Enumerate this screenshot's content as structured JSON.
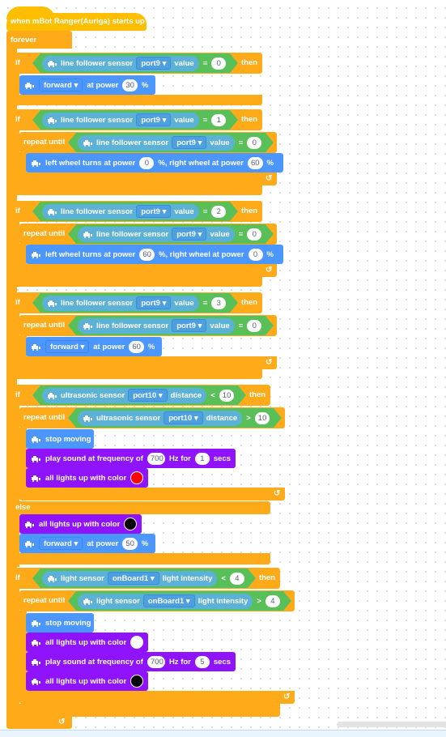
{
  "hat": {
    "label": "when mBot Ranger(Auriga) starts up"
  },
  "forever": {
    "label": "forever"
  },
  "keywords": {
    "if": "if",
    "then": "then",
    "else": "else",
    "repeat_until": "repeat until",
    "percent": "%",
    "loop_arrow": "↺"
  },
  "blocks": {
    "if1": {
      "cond": {
        "sensor": "line follower sensor",
        "port": "port9",
        "field": "value",
        "op": "=",
        "value": "0"
      },
      "body": [
        {
          "type": "move",
          "direction": "forward",
          "at_power": "at power",
          "power": "30",
          "unit": "%"
        }
      ]
    },
    "if2": {
      "cond": {
        "sensor": "line follower sensor",
        "port": "port9",
        "field": "value",
        "op": "=",
        "value": "1"
      },
      "until": {
        "sensor": "line follower sensor",
        "port": "port9",
        "field": "value",
        "op": "=",
        "value": "0"
      },
      "body": [
        {
          "type": "wheels",
          "left_label": "left wheel turns at power",
          "left": "0",
          "mid": "%,  right wheel at power",
          "right": "60",
          "unit": "%"
        }
      ]
    },
    "if3": {
      "cond": {
        "sensor": "line follower sensor",
        "port": "port9",
        "field": "value",
        "op": "=",
        "value": "2"
      },
      "until": {
        "sensor": "line follower sensor",
        "port": "port9",
        "field": "value",
        "op": "=",
        "value": "0"
      },
      "body": [
        {
          "type": "wheels",
          "left_label": "left wheel turns at power",
          "left": "60",
          "mid": "%,  right wheel at power",
          "right": "0",
          "unit": "%"
        }
      ]
    },
    "if4": {
      "cond": {
        "sensor": "line follower sensor",
        "port": "port9",
        "field": "value",
        "op": "=",
        "value": "3"
      },
      "until": {
        "sensor": "line follower sensor",
        "port": "port9",
        "field": "value",
        "op": "=",
        "value": "0"
      },
      "body": [
        {
          "type": "move",
          "direction": "forward",
          "at_power": "at power",
          "power": "60",
          "unit": "%"
        }
      ]
    },
    "if5": {
      "cond": {
        "sensor": "ultrasonic sensor",
        "port": "port10",
        "field": "distance",
        "op": "<",
        "value": "10"
      },
      "until": {
        "sensor": "ultrasonic sensor",
        "port": "port10",
        "field": "distance",
        "op": ">",
        "value": "10"
      },
      "body": [
        {
          "type": "stop",
          "label": "stop moving"
        },
        {
          "type": "sound",
          "prefix": "play sound at frequency of",
          "freq": "700",
          "mid": "Hz for",
          "secs": "1",
          "suffix": "secs"
        },
        {
          "type": "lights",
          "label": "all lights up with color",
          "color": "#FF0000"
        }
      ],
      "else": [
        {
          "type": "lights",
          "label": "all lights up with color",
          "color": "#000000"
        },
        {
          "type": "move",
          "direction": "forward",
          "at_power": "at power",
          "power": "50",
          "unit": "%"
        }
      ]
    },
    "if6": {
      "cond": {
        "sensor": "light sensor",
        "port": "onBoard1",
        "field": "light intensity",
        "op": "<",
        "value": "4"
      },
      "until": {
        "sensor": "light sensor",
        "port": "onBoard1",
        "field": "light intensity",
        "op": ">",
        "value": "4"
      },
      "body": [
        {
          "type": "stop",
          "label": "stop moving"
        },
        {
          "type": "lights",
          "label": "all lights up with color",
          "color": "#FFFFFF"
        },
        {
          "type": "sound",
          "prefix": "play sound at frequency of",
          "freq": "700",
          "mid": "Hz for",
          "secs": "5",
          "suffix": "secs"
        },
        {
          "type": "lights",
          "label": "all lights up with color",
          "color": "#000000"
        }
      ]
    }
  },
  "dropdown_arrow": "▾",
  "colors": {
    "events": "#FFBF00",
    "control": "#FFAB19",
    "operators": "#59C059",
    "sensing": "#5CB1D6",
    "motion": "#4C97FF",
    "looks": "#9013FE"
  }
}
